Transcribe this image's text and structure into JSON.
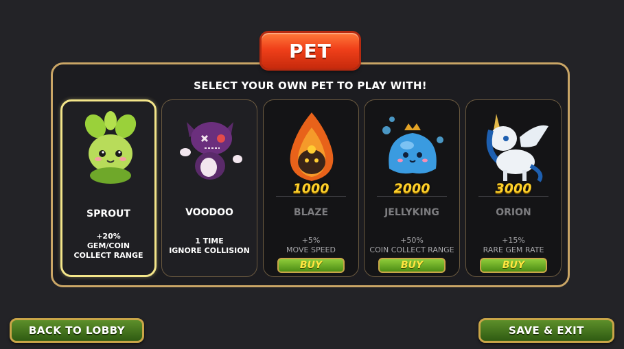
{
  "header": {
    "title": "PET"
  },
  "panel": {
    "subtitle": "SELECT YOUR OWN PET TO PLAY WITH!"
  },
  "pets": [
    {
      "name": "SPROUT",
      "description": "+20%\nGEM/COIN\nCOLLECT RANGE",
      "state": "selected",
      "icon": "sprout-pet-icon"
    },
    {
      "name": "VOODOO",
      "description": "1 TIME\nIGNORE COLLISION",
      "state": "owned",
      "icon": "voodoo-pet-icon"
    },
    {
      "name": "BLAZE",
      "description": "+5%\nMOVE SPEED",
      "state": "locked",
      "price": "1000",
      "buy_label": "BUY",
      "icon": "blaze-pet-icon"
    },
    {
      "name": "JELLYKING",
      "description": "+50%\nCOIN COLLECT RANGE",
      "state": "locked",
      "price": "2000",
      "buy_label": "BUY",
      "icon": "jellyking-pet-icon"
    },
    {
      "name": "ORION",
      "description": "+15%\nRARE GEM RATE",
      "state": "locked",
      "price": "3000",
      "buy_label": "BUY",
      "icon": "orion-pet-icon"
    }
  ],
  "footer": {
    "back_label": "BACK TO LOBBY",
    "save_label": "SAVE & EXIT"
  },
  "colors": {
    "title_banner": "#f0401a",
    "panel_border": "#c9a566",
    "selected_border": "#f3e58a",
    "price": "#ffd12a",
    "button_green": "#4c8d14"
  }
}
